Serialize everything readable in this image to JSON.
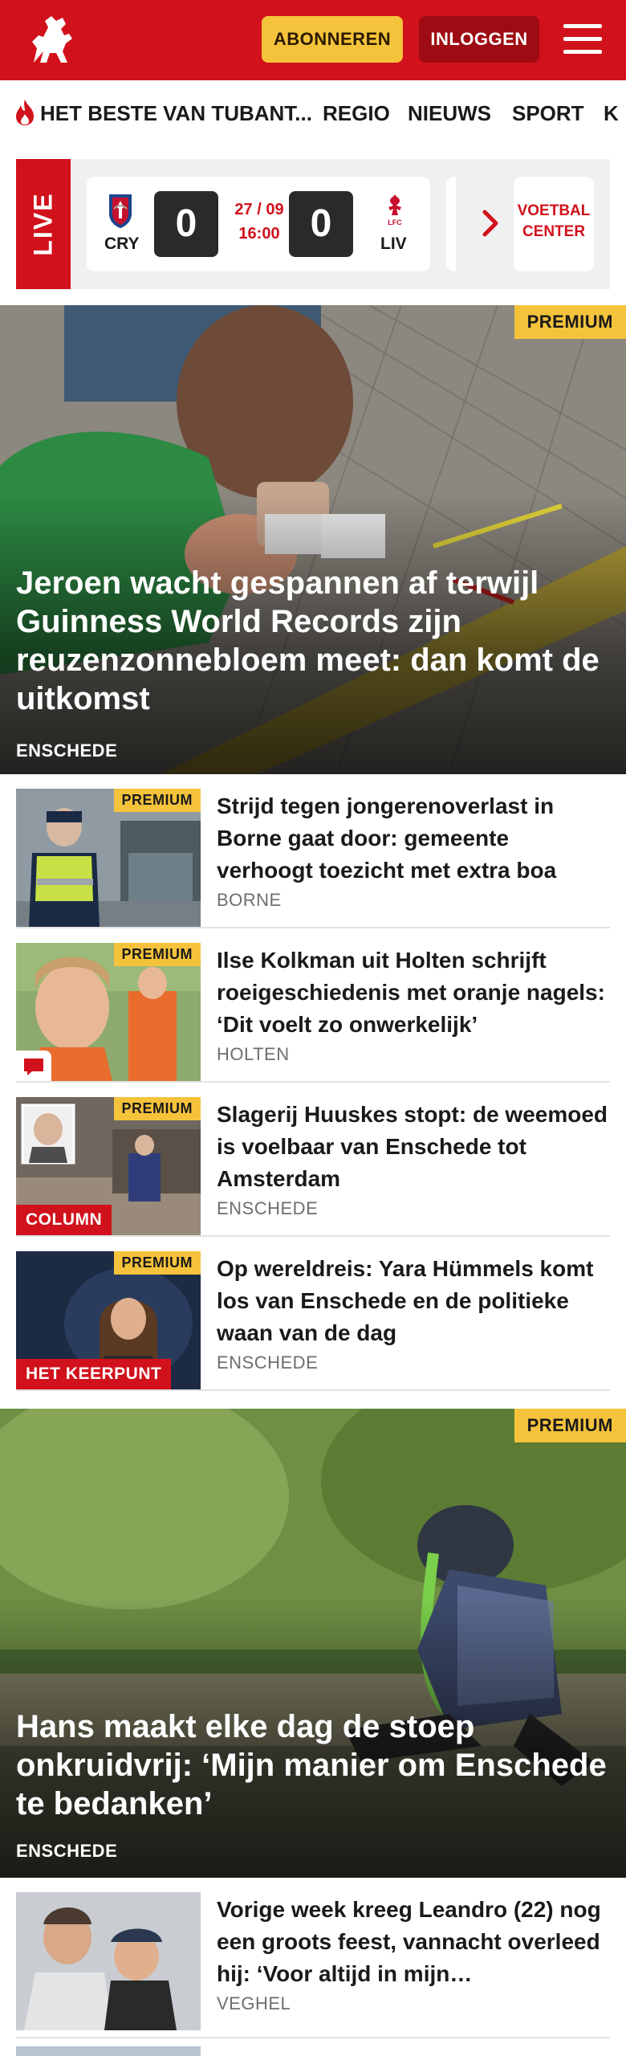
{
  "header": {
    "logo": "tubantia-horse-logo",
    "subscribe_label": "ABONNEREN",
    "login_label": "INLOGGEN",
    "menu_icon": "hamburger-menu-icon",
    "brand_color": "#d1111b",
    "accent_color": "#f5c33b"
  },
  "nav": {
    "items": [
      {
        "label": "HET BESTE VAN TUBANT..."
      },
      {
        "label": "REGIO"
      },
      {
        "label": "NIEUWS"
      },
      {
        "label": "SPORT"
      },
      {
        "label": "K"
      }
    ]
  },
  "live": {
    "tag": "LIVE",
    "match": {
      "home_abbr": "CRY",
      "home_score": "0",
      "date": "27 / 09",
      "time": "16:00",
      "away_score": "0",
      "away_abbr": "LIV"
    },
    "voetbal_center_label": "VOETBAL CENTER"
  },
  "hero1": {
    "premium": "PREMIUM",
    "title": "Jeroen wacht gespannen af terwijl Guinness World Records zijn reuzenzonnebloem meet: dan komt de uitkomst",
    "location": "ENSCHEDE"
  },
  "articles": [
    {
      "premium": "PREMIUM",
      "title": "Strijd tegen jongerenoverlast in Borne gaat door: gemeente verhoogt toezicht met extra boa",
      "location": "BORNE"
    },
    {
      "premium": "PREMIUM",
      "title": "Ilse Kolkman uit Holten schrijft roeigeschiedenis met oranje nagels: ‘Dit voelt zo onwerkelijk’",
      "location": "HOLTEN"
    },
    {
      "premium": "PREMIUM",
      "tag": "COLUMN",
      "title": "Slagerij Huuskes stopt: de weemoed is voelbaar van Enschede tot Amsterdam",
      "location": "ENSCHEDE"
    },
    {
      "premium": "PREMIUM",
      "tag": "HET KEERPUNT",
      "title": "Op wereldreis: Yara Hümmels komt los van Enschede en de politieke waan van de dag",
      "location": "ENSCHEDE"
    }
  ],
  "hero2": {
    "premium": "PREMIUM",
    "title": "Hans maakt elke dag de stoep onkruidvrij: ‘Mijn manier om Enschede te bedanken’",
    "location": "ENSCHEDE"
  },
  "article_last": {
    "title": "Vorige week kreeg Leandro (22) nog een groots feest, vannacht overleed hij: ‘Voor altijd in mijn…",
    "location": "VEGHEL"
  }
}
